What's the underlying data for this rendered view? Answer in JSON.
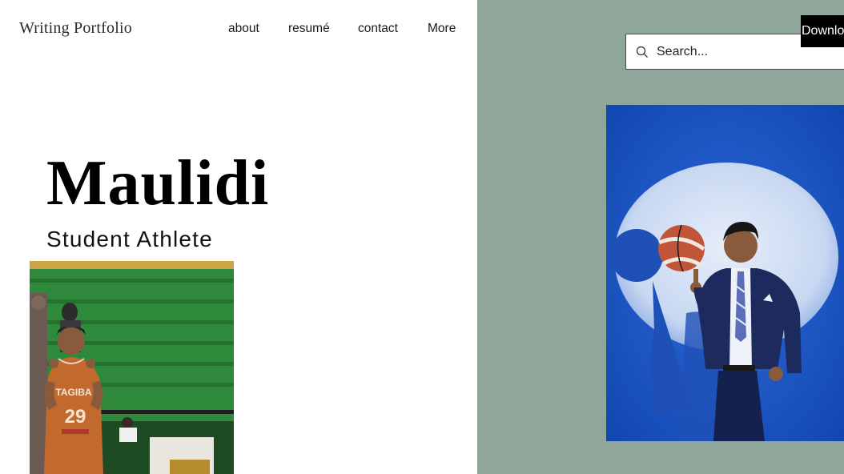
{
  "header": {
    "site_title": "Writing Portfolio",
    "nav": [
      "about",
      "resumé",
      "contact",
      "More"
    ]
  },
  "search": {
    "placeholder": "Search..."
  },
  "download_button": {
    "label": "Downlo"
  },
  "hero": {
    "name": "Maulidi",
    "tagline": "Student Athlete"
  },
  "images": {
    "left": {
      "jersey_text": "TAGIBA",
      "jersey_number": "29"
    }
  },
  "colors": {
    "panel": "#8fa69a",
    "spotlight_bg": "#1a55c2",
    "court_green": "#2e8a3a",
    "jersey": "#c2692e"
  }
}
